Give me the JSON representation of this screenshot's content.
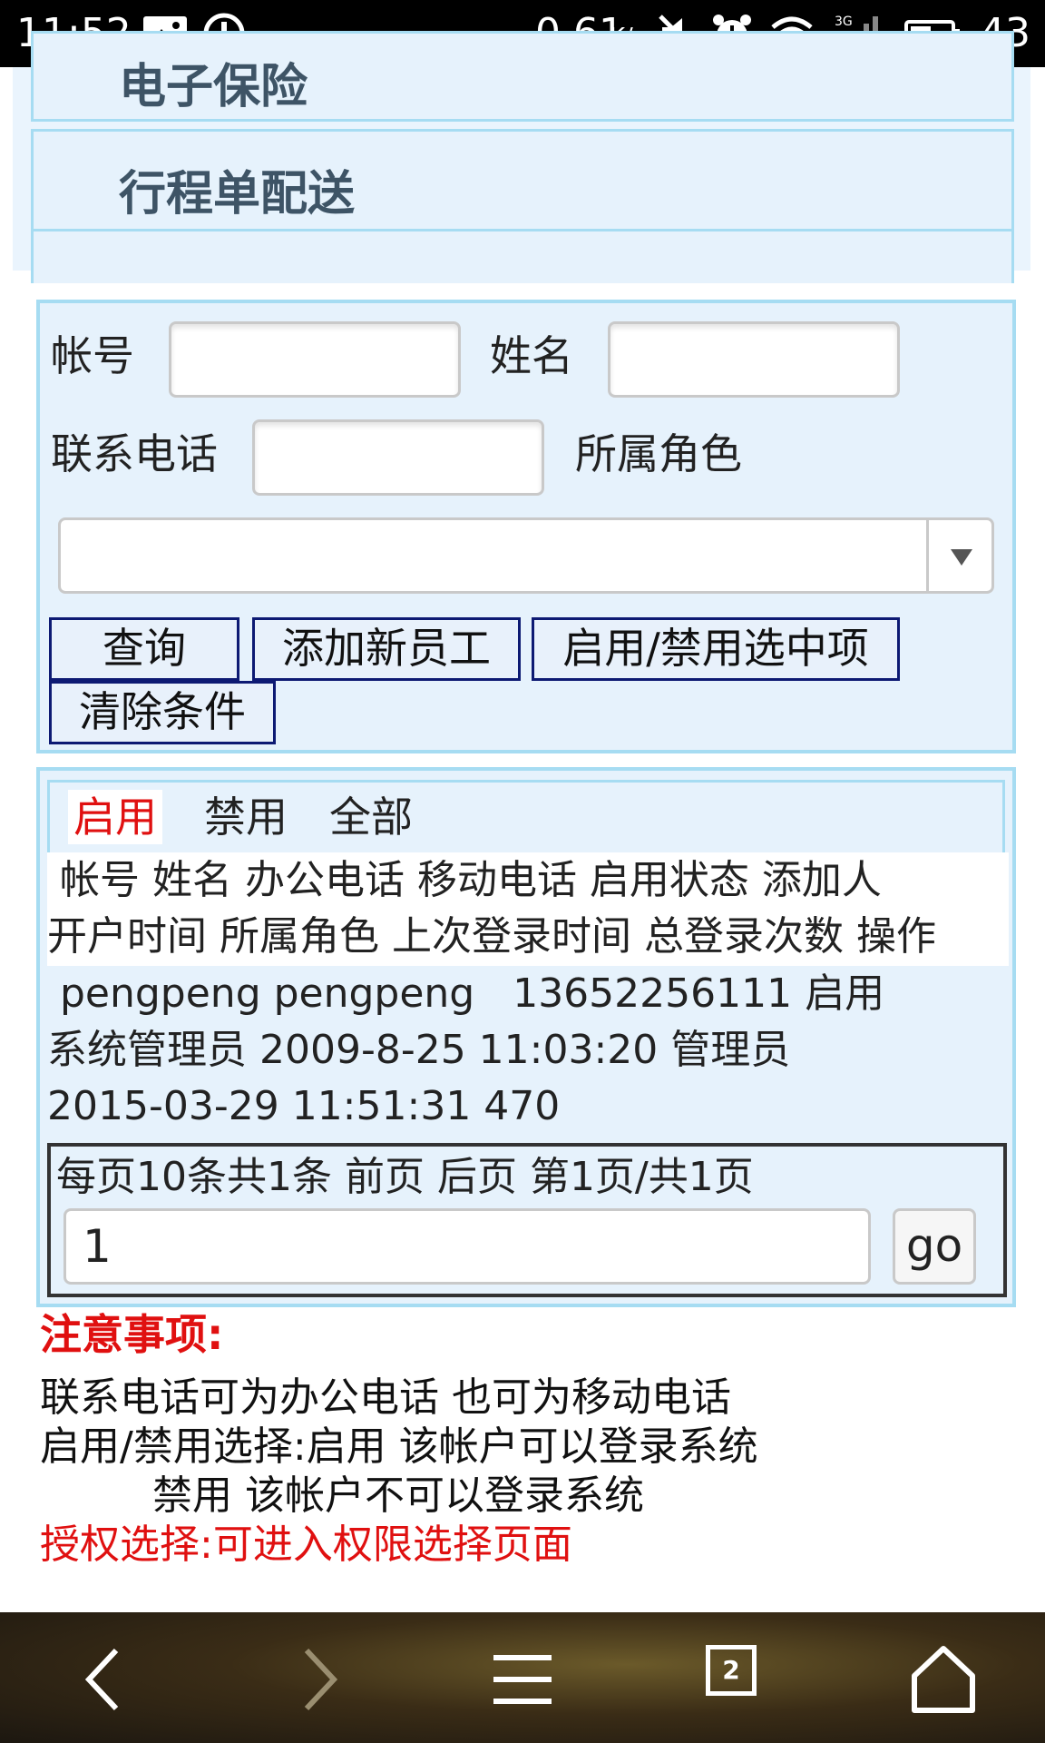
{
  "status_bar": {
    "time": "11:52",
    "speed": "0.61",
    "speed_unit": "K/s",
    "battery": "43",
    "icons": [
      "image-icon",
      "alert-icon",
      "mute-icon",
      "alarm-icon",
      "wifi-icon",
      "signal-3g-icon",
      "battery-icon"
    ]
  },
  "menu": {
    "items": [
      {
        "label": "电子保险"
      },
      {
        "label": "行程单配送"
      }
    ]
  },
  "search": {
    "account_label": "帐号",
    "name_label": "姓名",
    "phone_label": "联系电话",
    "role_label": "所属角色",
    "account_value": "",
    "name_value": "",
    "phone_value": "",
    "role_value": ""
  },
  "buttons": {
    "query": "查询",
    "add_employee": "添加新员工",
    "toggle": "启用/禁用选中项",
    "clear": "清除条件"
  },
  "tabs": [
    "启用",
    "禁用",
    "全部"
  ],
  "table": {
    "header_line1": " 帐号 姓名 办公电话 移动电话 启用状态 添加人",
    "header_line2": "开户时间 所属角色 上次登录时间 总登录次数 操作",
    "row_line1": " pengpeng pengpeng   13652256111 启用",
    "row_line2": "系统管理员 2009-8-25 11:03:20 管理员",
    "row_line3": "2015-03-29 11:51:31 470"
  },
  "pager": {
    "info": "每页10条共1条 前页 后页 第1页/共1页",
    "page_value": "1",
    "go": "go"
  },
  "notes": {
    "title": "注意事项:",
    "line1": "联系电话可为办公电话 也可为移动电话",
    "line2": "启用/禁用选择:启用 该帐户可以登录系统",
    "line3": "禁用 该帐户不可以登录系统",
    "line4": "授权选择:可进入权限选择页面"
  },
  "nav": {
    "tabs_count": "2"
  },
  "colors": {
    "panel_bg": "#e6f2fc",
    "panel_border": "#a6dcf2",
    "button_border": "#0d1a73",
    "accent_red": "#e01010"
  }
}
